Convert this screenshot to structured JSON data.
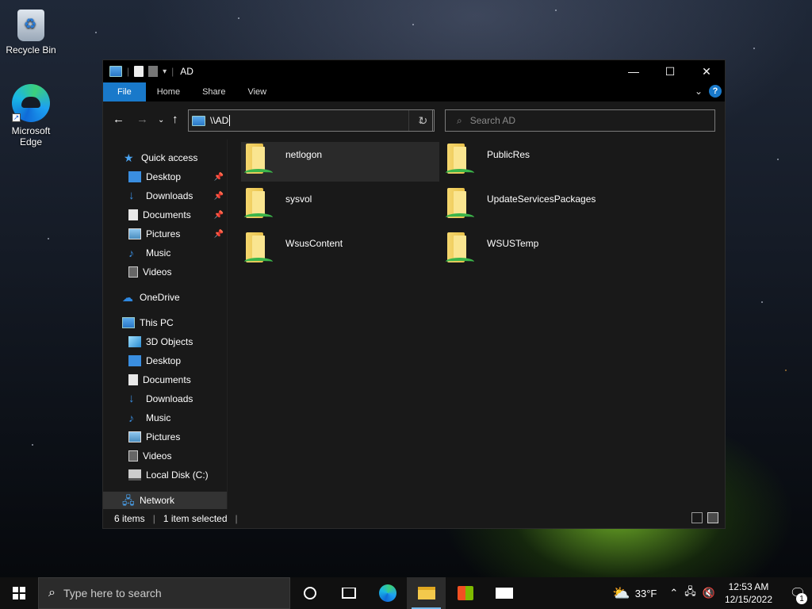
{
  "desktop": {
    "icons": [
      {
        "label": "Recycle Bin"
      },
      {
        "label": "Microsoft Edge"
      }
    ]
  },
  "window": {
    "title": "AD",
    "ribbon_tabs": [
      "File",
      "Home",
      "Share",
      "View"
    ],
    "address": {
      "value": "\\\\AD"
    },
    "search": {
      "placeholder": "Search AD"
    },
    "sidebar": {
      "quick_access": "Quick access",
      "quick_items": [
        "Desktop",
        "Downloads",
        "Documents",
        "Pictures",
        "Music",
        "Videos"
      ],
      "onedrive": "OneDrive",
      "this_pc": "This PC",
      "pc_items": [
        "3D Objects",
        "Desktop",
        "Documents",
        "Downloads",
        "Music",
        "Pictures",
        "Videos",
        "Local Disk (C:)"
      ],
      "network": "Network"
    },
    "folders": [
      "netlogon",
      "PublicRes",
      "sysvol",
      "UpdateServicesPackages",
      "WsusContent",
      "WSUSTemp"
    ],
    "status": {
      "items": "6 items",
      "selected": "1 item selected"
    }
  },
  "taskbar": {
    "search_placeholder": "Type here to search",
    "weather": "33°F",
    "time": "12:53 AM",
    "date": "12/15/2022",
    "notifications": "1"
  }
}
